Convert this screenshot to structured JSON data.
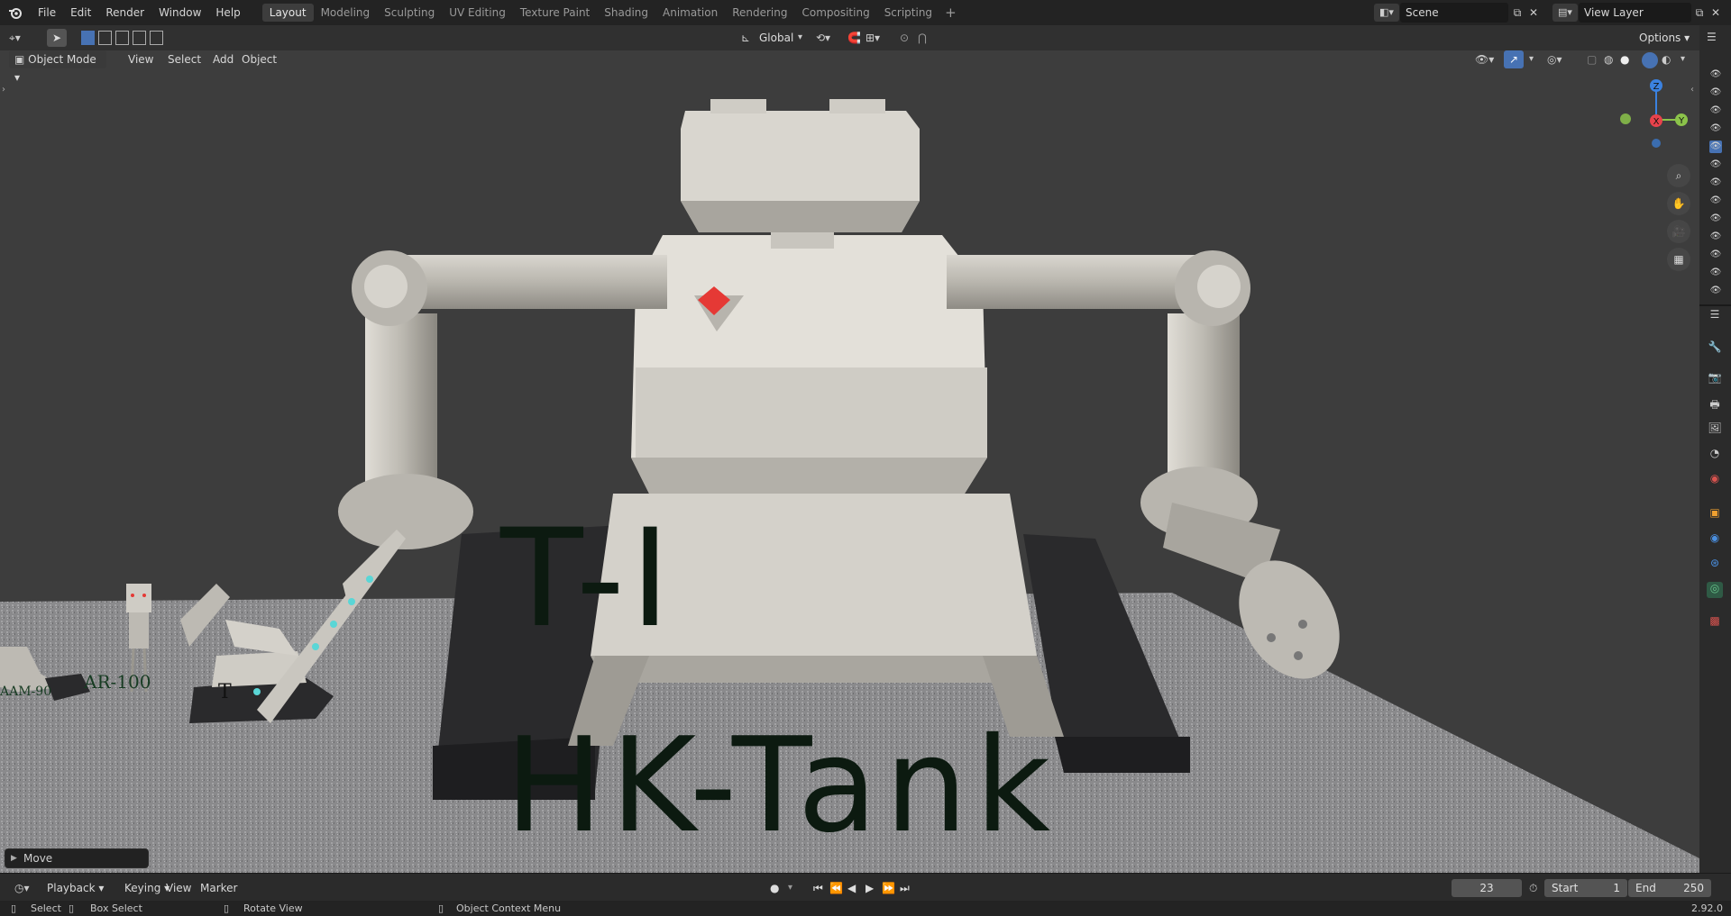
{
  "topbar": {
    "menu": [
      "File",
      "Edit",
      "Render",
      "Window",
      "Help"
    ],
    "workspaces": [
      "Layout",
      "Modeling",
      "Sculpting",
      "UV Editing",
      "Texture Paint",
      "Shading",
      "Animation",
      "Rendering",
      "Compositing",
      "Scripting"
    ],
    "active_workspace": "Layout",
    "add_tab": "+",
    "scene_name": "Scene",
    "view_layer": "View Layer"
  },
  "toolbar": {
    "transform_orientation": "Global",
    "options_label": "Options"
  },
  "header3d": {
    "mode": "Object Mode",
    "view": "View",
    "select": "Select",
    "add": "Add",
    "object": "Object"
  },
  "gizmo": {
    "z": "Z",
    "x": "X",
    "y": "Y"
  },
  "viewport_text": {
    "title_top": "T-I",
    "title_bottom": "HK-Tank",
    "label_ar": "AR-100",
    "label_aam": "AAM-90",
    "label_t": "T"
  },
  "last_op": "Move",
  "timeline": {
    "playback": "Playback",
    "keying": "Keying",
    "view": "View",
    "marker": "Marker",
    "current_frame": "23",
    "start_label": "Start",
    "start": "1",
    "end_label": "End",
    "end": "250"
  },
  "statusbar": {
    "select": "Select",
    "box_select": "Box Select",
    "rotate_view": "Rotate View",
    "context_menu": "Object Context Menu",
    "version": "2.92.0"
  },
  "colors": {
    "accent": "#4772b3",
    "gizmo_x": "#e8424b",
    "gizmo_y": "#8bc34a",
    "gizmo_z": "#3b82e0",
    "text_3d": "#0c1a10"
  }
}
